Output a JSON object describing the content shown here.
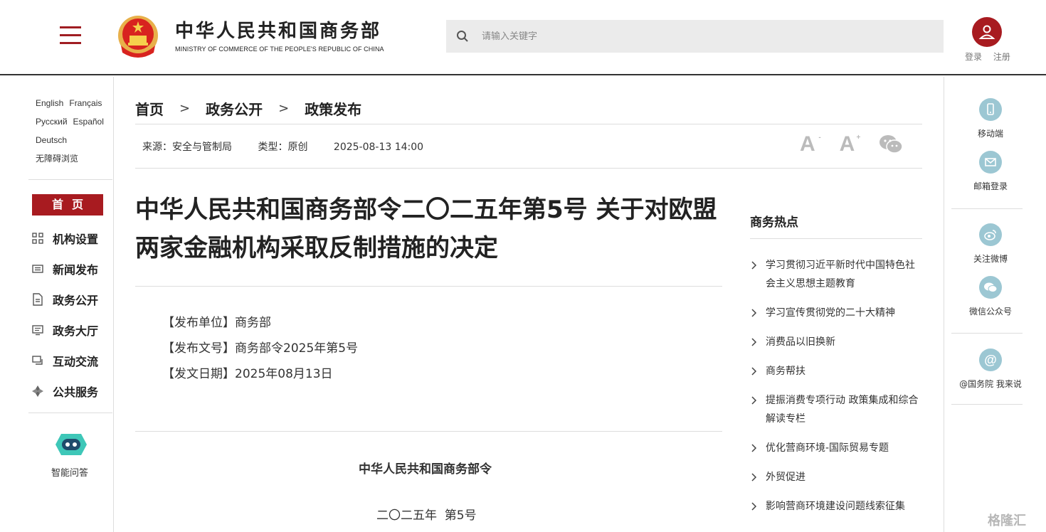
{
  "header": {
    "brand_cn": "中华人民共和国商务部",
    "brand_en": "MINISTRY OF COMMERCE OF THE PEOPLE'S REPUBLIC OF CHINA",
    "search_placeholder": "请输入关键字",
    "login": "登录",
    "register": "注册"
  },
  "languages": [
    "English",
    "Français",
    "Русский",
    "Español",
    "Deutsch"
  ],
  "accessibility": "无障碍浏览",
  "left_nav": {
    "home": "首页",
    "items": [
      {
        "label": "机构设置",
        "icon": "grid-icon"
      },
      {
        "label": "新闻发布",
        "icon": "news-icon"
      },
      {
        "label": "政务公开",
        "icon": "document-icon"
      },
      {
        "label": "政务大厅",
        "icon": "monitor-icon"
      },
      {
        "label": "互动交流",
        "icon": "chat-icon"
      },
      {
        "label": "公共服务",
        "icon": "service-icon"
      }
    ],
    "assistant": "智能问答"
  },
  "breadcrumb": [
    "首页",
    "政务公开",
    "政策发布"
  ],
  "meta": {
    "source": "来源：安全与管制局",
    "type": "类型：原创",
    "datetime": "2025-08-13 14:00"
  },
  "article": {
    "title": "中华人民共和国商务部令二〇二五年第5号 关于对欧盟两家金融机构采取反制措施的决定",
    "issuer": "【发布单位】商务部",
    "doc_no": "【发布文号】商务部令2025年第5号",
    "date": "【发文日期】2025年08月13日",
    "doc_head": "中华人民共和国商务部令",
    "doc_num": "二〇二五年  第5号"
  },
  "hot": {
    "title": "商务热点",
    "items": [
      "学习贯彻习近平新时代中国特色社会主义思想主题教育",
      "学习宣传贯彻党的二十大精神",
      "消费品以旧换新",
      "商务帮扶",
      "提振消费专项行动 政策集成和综合解读专栏",
      "优化营商环境-国际贸易专题",
      "外贸促进",
      "影响营商环境建设问题线索征集"
    ]
  },
  "right_bar": {
    "mobile": "移动端",
    "mail": "邮箱登录",
    "weibo": "关注微博",
    "wechat": "微信公众号",
    "council": "@国务院 我来说"
  },
  "watermark": "格隆汇",
  "colors": {
    "accent": "#a81b20",
    "icon_teal": "#9cc7d3"
  }
}
